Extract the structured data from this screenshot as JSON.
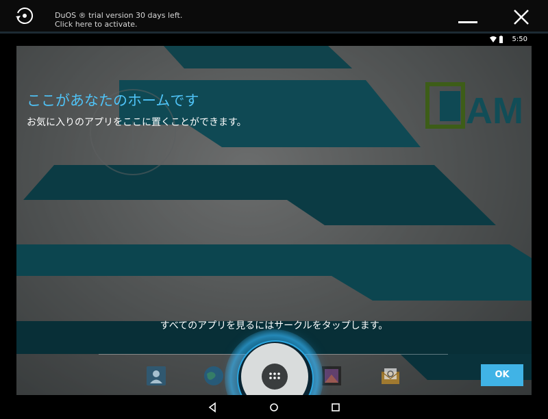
{
  "titlebar": {
    "trial_line1": "DuOS ® trial version 30 days left.",
    "trial_line2": "Click here to activate."
  },
  "statusbar": {
    "time": "5:50"
  },
  "home": {
    "title": "ここがあなたのホームです",
    "subtitle": "お気に入りのアプリをここに置くことができます。",
    "tap_hint": "すべてのアプリを見るにはサークルをタップします。",
    "ok_label": "OK"
  },
  "wallpaper": {
    "logo_text": "AM"
  },
  "icons": {
    "dock": [
      "contacts-icon",
      "browser-globe-icon",
      "gallery-icon",
      "email-icon"
    ],
    "nav": [
      "back-icon",
      "home-icon",
      "recents-icon"
    ]
  },
  "colors": {
    "accent": "#40b3e6",
    "title_blue": "#4fc3f7"
  }
}
